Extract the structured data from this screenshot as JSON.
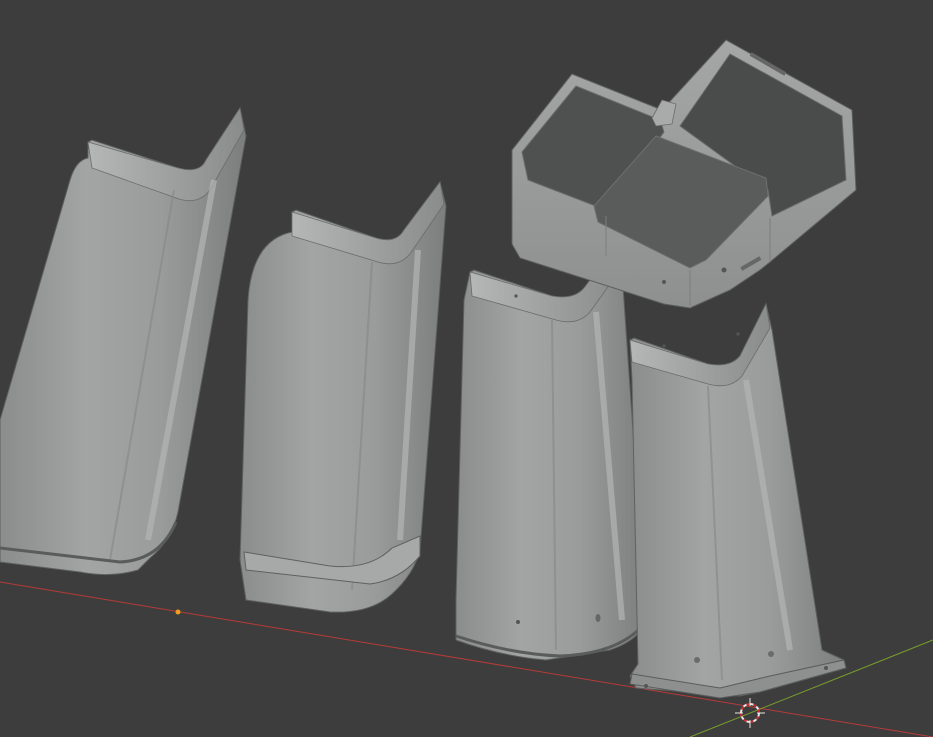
{
  "viewport": {
    "background": "#3d3d3d",
    "mesh_color": "#9a9c9c",
    "mesh_shadow": "#7d7f7f",
    "edge_color": "#5f6060",
    "x_axis_color": "#b83a3a",
    "y_axis_color": "#7aa02c",
    "origin_color": "#f29b1e",
    "cursor_color": "#e8e8e8",
    "cursor_accent": "#d03030",
    "icons": [
      "3d-cursor-icon",
      "object-origin-icon"
    ]
  }
}
